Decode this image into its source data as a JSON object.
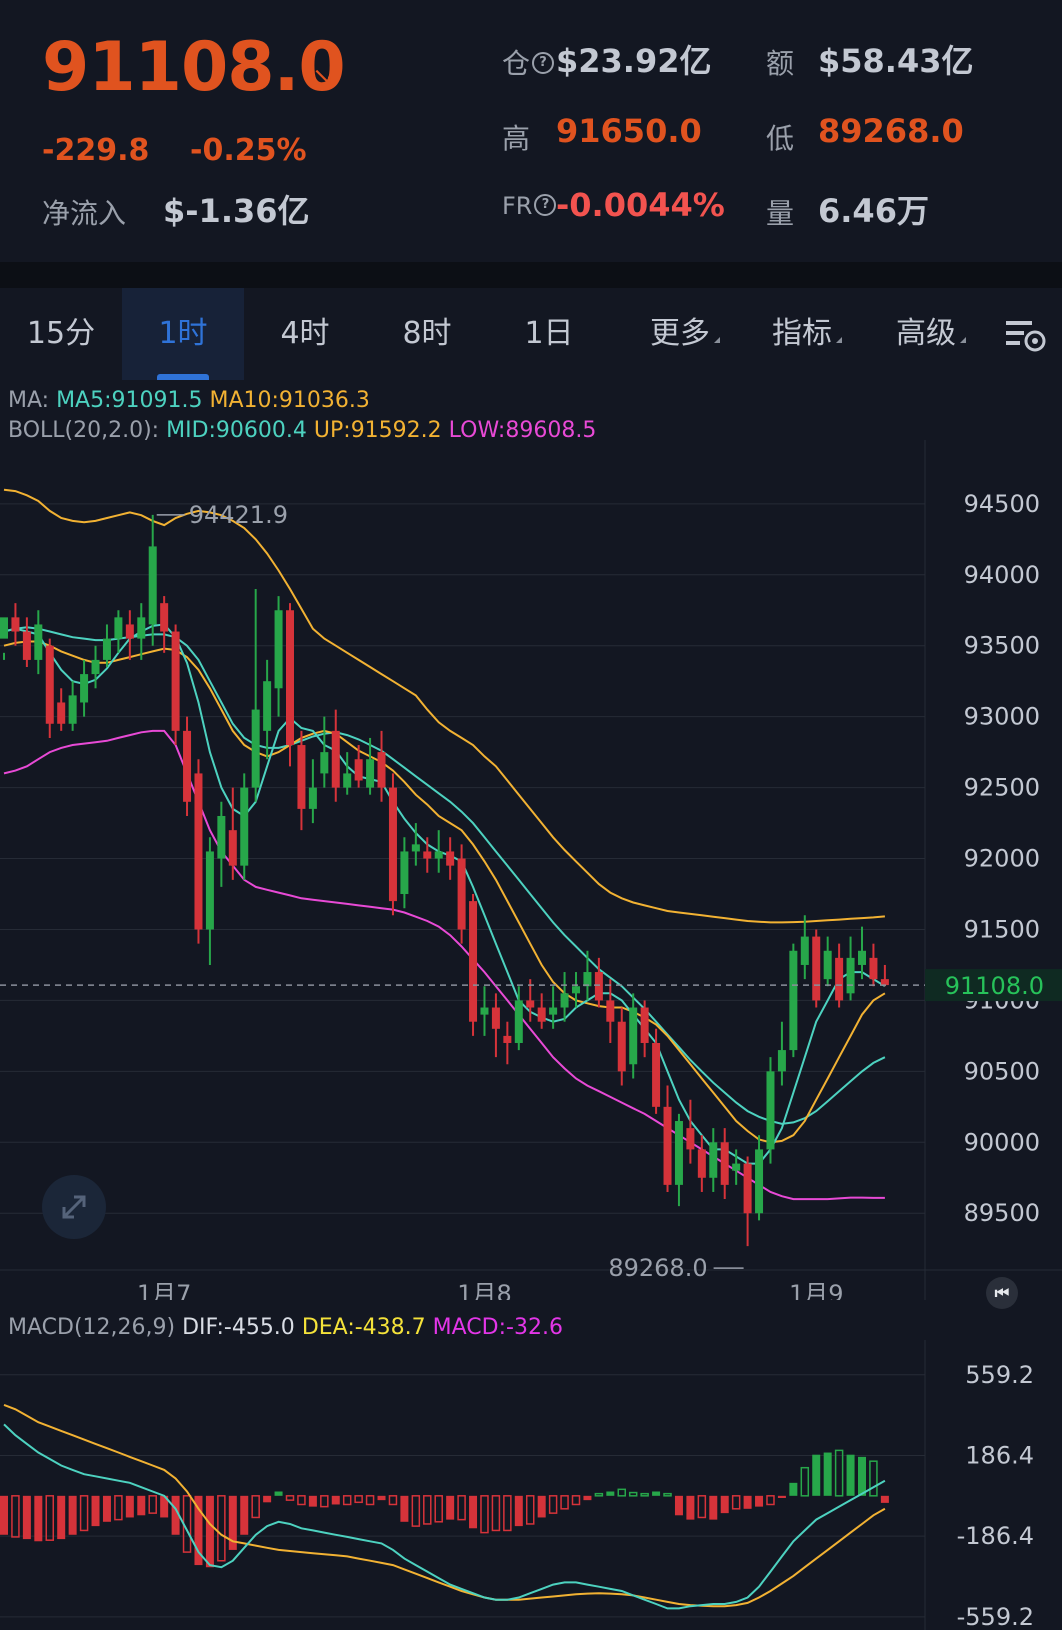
{
  "header": {
    "price": "91108.0",
    "change_abs": "-229.8",
    "change_pct": "-0.25%",
    "netflow_label": "净流入",
    "netflow_value": "$-1.36亿",
    "oi_label": "仓",
    "oi_value": "$23.92亿",
    "amount_label": "额",
    "amount_value": "$58.43亿",
    "high_label": "高",
    "high_value": "91650.0",
    "low_label": "低",
    "low_value": "89268.0",
    "fr_label": "FR",
    "fr_value": "-0.0044%",
    "vol_label": "量",
    "vol_value": "6.46万",
    "colors": {
      "down": "#e0531f",
      "fr": "#f2534f"
    }
  },
  "tabs": [
    {
      "label": "15分"
    },
    {
      "label": "1时",
      "active": true
    },
    {
      "label": "4时"
    },
    {
      "label": "8时"
    },
    {
      "label": "1日"
    },
    {
      "label": "更多"
    },
    {
      "label": "指标"
    },
    {
      "label": "高级"
    }
  ],
  "legend": {
    "ma_prefix": "MA:",
    "ma5": "MA5:91091.5",
    "ma10": "MA10:91036.3",
    "boll_prefix": "BOLL(20,2.0):",
    "mid": "MID:90600.4",
    "up": "UP:91592.2",
    "low": "LOW:89608.5"
  },
  "macd_legend": {
    "prefix": "MACD(12,26,9)",
    "dif": "DIF:-455.0",
    "dea": "DEA:-438.7",
    "macd": "MACD:-32.6"
  },
  "chart_data": [
    {
      "type": "candlestick",
      "y_ticks": [
        94500,
        94000,
        93500,
        93000,
        92500,
        92000,
        91500,
        91000,
        90500,
        90000,
        89500
      ],
      "ylim": [
        89100,
        94950
      ],
      "x_labels": [
        "1月7",
        "1月8",
        "1月9"
      ],
      "last_price": 91108.0,
      "last_price_label": "91108.0",
      "annotations": [
        {
          "text": "94421.9",
          "value": 94421.9
        },
        {
          "text": "89268.0",
          "value": 89268.0
        }
      ],
      "candles": [
        [
          93550,
          93700,
          93450,
          93400
        ],
        [
          93700,
          93600,
          93800,
          93500
        ],
        [
          93600,
          93400,
          93700,
          93350
        ],
        [
          93400,
          93650,
          93750,
          93300
        ],
        [
          93500,
          92950,
          93550,
          92850
        ],
        [
          93100,
          92950,
          93200,
          92900
        ],
        [
          92950,
          93150,
          93250,
          92900
        ],
        [
          93100,
          93300,
          93400,
          93000
        ],
        [
          93300,
          93400,
          93500,
          93200
        ],
        [
          93400,
          93550,
          93650,
          93350
        ],
        [
          93550,
          93700,
          93750,
          93450
        ],
        [
          93650,
          93550,
          93750,
          93400
        ],
        [
          93550,
          93700,
          93800,
          93400
        ],
        [
          93650,
          94200,
          94421.9,
          93500
        ],
        [
          93800,
          93600,
          93850,
          93450
        ],
        [
          93600,
          92900,
          93650,
          92800
        ],
        [
          92900,
          92400,
          93000,
          92300
        ],
        [
          92600,
          91500,
          92700,
          91400
        ],
        [
          91500,
          92050,
          92150,
          91250
        ],
        [
          92000,
          92300,
          92400,
          91800
        ],
        [
          92200,
          91950,
          92500,
          91850
        ],
        [
          91950,
          92500,
          92600,
          91850
        ],
        [
          92500,
          93050,
          93900,
          92400
        ],
        [
          92900,
          93250,
          93400,
          92700
        ],
        [
          93200,
          93750,
          93850,
          93000
        ],
        [
          93750,
          92800,
          93800,
          92650
        ],
        [
          92800,
          92350,
          92900,
          92200
        ],
        [
          92350,
          92500,
          92700,
          92250
        ],
        [
          92600,
          92750,
          93000,
          92500
        ],
        [
          92900,
          92500,
          93050,
          92400
        ],
        [
          92500,
          92600,
          92750,
          92450
        ],
        [
          92700,
          92550,
          92800,
          92500
        ],
        [
          92500,
          92700,
          92850,
          92450
        ],
        [
          92750,
          92500,
          92900,
          92400
        ],
        [
          92500,
          91700,
          92600,
          91600
        ],
        [
          91750,
          92050,
          92150,
          91650
        ],
        [
          92050,
          92100,
          92250,
          91950
        ],
        [
          92050,
          92000,
          92150,
          91900
        ],
        [
          92000,
          92050,
          92200,
          91900
        ],
        [
          92050,
          91950,
          92150,
          91850
        ],
        [
          92000,
          91500,
          92100,
          91400
        ],
        [
          91700,
          90850,
          91750,
          90750
        ],
        [
          90900,
          90950,
          91100,
          90750
        ],
        [
          90950,
          90800,
          91050,
          90600
        ],
        [
          90750,
          90700,
          90850,
          90550
        ],
        [
          90700,
          91000,
          91100,
          90650
        ],
        [
          91000,
          90950,
          91150,
          90850
        ],
        [
          90950,
          90850,
          91050,
          90800
        ],
        [
          90900,
          90950,
          91100,
          90800
        ],
        [
          90950,
          91050,
          91200,
          90850
        ],
        [
          91050,
          91100,
          91200,
          90950
        ],
        [
          91100,
          91200,
          91350,
          91000
        ],
        [
          91200,
          91000,
          91300,
          90950
        ],
        [
          91000,
          90850,
          91150,
          90700
        ],
        [
          90850,
          90500,
          90950,
          90400
        ],
        [
          90550,
          90950,
          91050,
          90450
        ],
        [
          90950,
          90700,
          91000,
          90600
        ],
        [
          90700,
          90250,
          90800,
          90200
        ],
        [
          90250,
          89700,
          90400,
          89650
        ],
        [
          89700,
          90150,
          90200,
          89550
        ],
        [
          90100,
          89950,
          90300,
          89850
        ],
        [
          89950,
          89750,
          90050,
          89650
        ],
        [
          89750,
          90000,
          90100,
          89650
        ],
        [
          90000,
          89700,
          90100,
          89600
        ],
        [
          89800,
          89850,
          89950,
          89700
        ],
        [
          89850,
          89500,
          89900,
          89268
        ],
        [
          89500,
          89950,
          90050,
          89450
        ],
        [
          89950,
          90500,
          90600,
          89850
        ],
        [
          90500,
          90650,
          90850,
          90400
        ],
        [
          90650,
          91350,
          91400,
          90600
        ],
        [
          91250,
          91450,
          91600,
          91150
        ],
        [
          91450,
          91000,
          91500,
          90950
        ],
        [
          91150,
          91350,
          91450,
          91100
        ],
        [
          91300,
          91000,
          91400,
          90950
        ],
        [
          91050,
          91300,
          91450,
          91000
        ],
        [
          91250,
          91350,
          91520,
          91150
        ],
        [
          91300,
          91150,
          91400,
          91100
        ],
        [
          91150,
          91108,
          91250,
          91100
        ]
      ],
      "ma5": [
        93600,
        93620,
        93600,
        93580,
        93450,
        93330,
        93250,
        93230,
        93260,
        93340,
        93450,
        93550,
        93600,
        93640,
        93650,
        93560,
        93380,
        93100,
        92750,
        92500,
        92350,
        92300,
        92400,
        92650,
        92900,
        92990,
        92920,
        92900,
        92800,
        92760,
        92650,
        92580,
        92560,
        92540,
        92400,
        92280,
        92180,
        92100,
        92050,
        92020,
        91980,
        91800,
        91600,
        91400,
        91200,
        91000,
        90920,
        90880,
        90850,
        90870,
        90950,
        91000,
        91050,
        91050,
        91000,
        90900,
        90800,
        90700,
        90500,
        90300,
        90150,
        90050,
        89950,
        89950,
        89900,
        89850,
        89850,
        89950,
        90100,
        90350,
        90600,
        90850,
        91000,
        91150,
        91200,
        91200,
        91150,
        91100
      ],
      "ma10": [
        93500,
        93520,
        93530,
        93530,
        93500,
        93460,
        93430,
        93400,
        93380,
        93380,
        93400,
        93420,
        93440,
        93460,
        93480,
        93470,
        93420,
        93330,
        93200,
        93050,
        92900,
        92800,
        92750,
        92720,
        92750,
        92800,
        92850,
        92880,
        92900,
        92880,
        92820,
        92760,
        92720,
        92680,
        92620,
        92540,
        92450,
        92380,
        92300,
        92250,
        92200,
        92100,
        91980,
        91850,
        91700,
        91550,
        91400,
        91250,
        91130,
        91050,
        91000,
        90980,
        90960,
        90950,
        90950,
        90920,
        90880,
        90830,
        90750,
        90650,
        90550,
        90450,
        90350,
        90250,
        90150,
        90080,
        90020,
        90000,
        90010,
        90050,
        90150,
        90300,
        90450,
        90600,
        90750,
        90900,
        91000,
        91050
      ],
      "boll_mid": [
        93600,
        93620,
        93630,
        93620,
        93600,
        93580,
        93560,
        93550,
        93540,
        93540,
        93550,
        93560,
        93570,
        93580,
        93580,
        93560,
        93500,
        93400,
        93250,
        93100,
        92950,
        92850,
        92800,
        92780,
        92780,
        92800,
        92830,
        92860,
        92880,
        92890,
        92870,
        92840,
        92800,
        92760,
        92700,
        92640,
        92580,
        92520,
        92460,
        92400,
        92330,
        92250,
        92150,
        92050,
        91950,
        91850,
        91750,
        91650,
        91550,
        91460,
        91380,
        91300,
        91220,
        91160,
        91100,
        91020,
        90940,
        90850,
        90760,
        90670,
        90580,
        90500,
        90420,
        90350,
        90280,
        90220,
        90180,
        90150,
        90130,
        90140,
        90170,
        90220,
        90290,
        90360,
        90430,
        90500,
        90560,
        90600
      ],
      "boll_up": [
        94600,
        94590,
        94560,
        94520,
        94450,
        94400,
        94380,
        94370,
        94380,
        94400,
        94420,
        94440,
        94420,
        94380,
        94350,
        94400,
        94430,
        94450,
        94440,
        94420,
        94380,
        94330,
        94250,
        94150,
        94030,
        93900,
        93760,
        93620,
        93550,
        93500,
        93450,
        93400,
        93350,
        93300,
        93250,
        93200,
        93150,
        93050,
        92960,
        92900,
        92850,
        92800,
        92720,
        92650,
        92550,
        92450,
        92350,
        92250,
        92150,
        92060,
        91980,
        91900,
        91820,
        91760,
        91720,
        91690,
        91670,
        91650,
        91630,
        91620,
        91610,
        91600,
        91590,
        91580,
        91570,
        91560,
        91555,
        91550,
        91550,
        91552,
        91555,
        91560,
        91565,
        91570,
        91575,
        91580,
        91585,
        91592
      ],
      "boll_low": [
        92600,
        92620,
        92650,
        92700,
        92750,
        92780,
        92800,
        92810,
        92820,
        92830,
        92850,
        92870,
        92890,
        92900,
        92900,
        92800,
        92600,
        92400,
        92200,
        92050,
        91950,
        91850,
        91800,
        91780,
        91760,
        91740,
        91720,
        91710,
        91700,
        91690,
        91680,
        91670,
        91660,
        91650,
        91640,
        91620,
        91590,
        91560,
        91520,
        91460,
        91380,
        91290,
        91200,
        91100,
        91000,
        90900,
        90800,
        90700,
        90600,
        90520,
        90450,
        90400,
        90360,
        90320,
        90280,
        90240,
        90200,
        90150,
        90100,
        90050,
        90000,
        89950,
        89900,
        89850,
        89800,
        89750,
        89700,
        89650,
        89620,
        89600,
        89600,
        89600,
        89600,
        89605,
        89610,
        89610,
        89608,
        89608
      ]
    },
    {
      "type": "macd",
      "y_ticks": [
        "559.2",
        "186.4",
        "-186.4",
        "-559.2"
      ],
      "ylim": [
        -620,
        720
      ],
      "hist": [
        -180,
        -190,
        -200,
        -210,
        -205,
        -200,
        -180,
        -160,
        -140,
        -120,
        -110,
        -100,
        -90,
        -80,
        -100,
        -180,
        -260,
        -320,
        -330,
        -300,
        -250,
        -180,
        -100,
        -30,
        20,
        -20,
        -40,
        -50,
        -50,
        -40,
        -40,
        -30,
        -40,
        -20,
        -40,
        -120,
        -140,
        -130,
        -120,
        -110,
        -110,
        -150,
        -170,
        -160,
        -160,
        -140,
        -130,
        -100,
        -80,
        -60,
        -40,
        -20,
        10,
        20,
        30,
        15,
        10,
        20,
        10,
        -90,
        -110,
        -100,
        -110,
        -80,
        -60,
        -60,
        -50,
        -40,
        -10,
        60,
        130,
        190,
        200,
        210,
        190,
        180,
        160,
        -32.6
      ],
      "dif": [
        330,
        280,
        240,
        200,
        170,
        140,
        120,
        100,
        90,
        80,
        70,
        60,
        40,
        20,
        0,
        -60,
        -160,
        -260,
        -320,
        -330,
        -300,
        -240,
        -180,
        -140,
        -120,
        -130,
        -150,
        -160,
        -170,
        -180,
        -190,
        -200,
        -210,
        -220,
        -250,
        -290,
        -320,
        -350,
        -380,
        -410,
        -430,
        -450,
        -470,
        -480,
        -480,
        -470,
        -450,
        -430,
        -410,
        -400,
        -400,
        -410,
        -420,
        -430,
        -440,
        -460,
        -480,
        -500,
        -520,
        -520,
        -510,
        -505,
        -500,
        -500,
        -490,
        -470,
        -420,
        -350,
        -280,
        -210,
        -160,
        -110,
        -80,
        -50,
        -20,
        10,
        40,
        70
      ],
      "dea": [
        420,
        400,
        370,
        340,
        320,
        300,
        280,
        260,
        240,
        220,
        200,
        180,
        160,
        140,
        120,
        80,
        20,
        -60,
        -130,
        -180,
        -210,
        -220,
        -230,
        -240,
        -250,
        -255,
        -260,
        -265,
        -270,
        -275,
        -280,
        -290,
        -300,
        -310,
        -320,
        -340,
        -360,
        -380,
        -400,
        -420,
        -440,
        -455,
        -470,
        -480,
        -480,
        -480,
        -475,
        -470,
        -465,
        -460,
        -455,
        -452,
        -450,
        -452,
        -455,
        -460,
        -470,
        -480,
        -490,
        -500,
        -505,
        -508,
        -510,
        -510,
        -505,
        -495,
        -470,
        -440,
        -405,
        -370,
        -330,
        -290,
        -250,
        -210,
        -170,
        -130,
        -90,
        -60
      ]
    }
  ]
}
